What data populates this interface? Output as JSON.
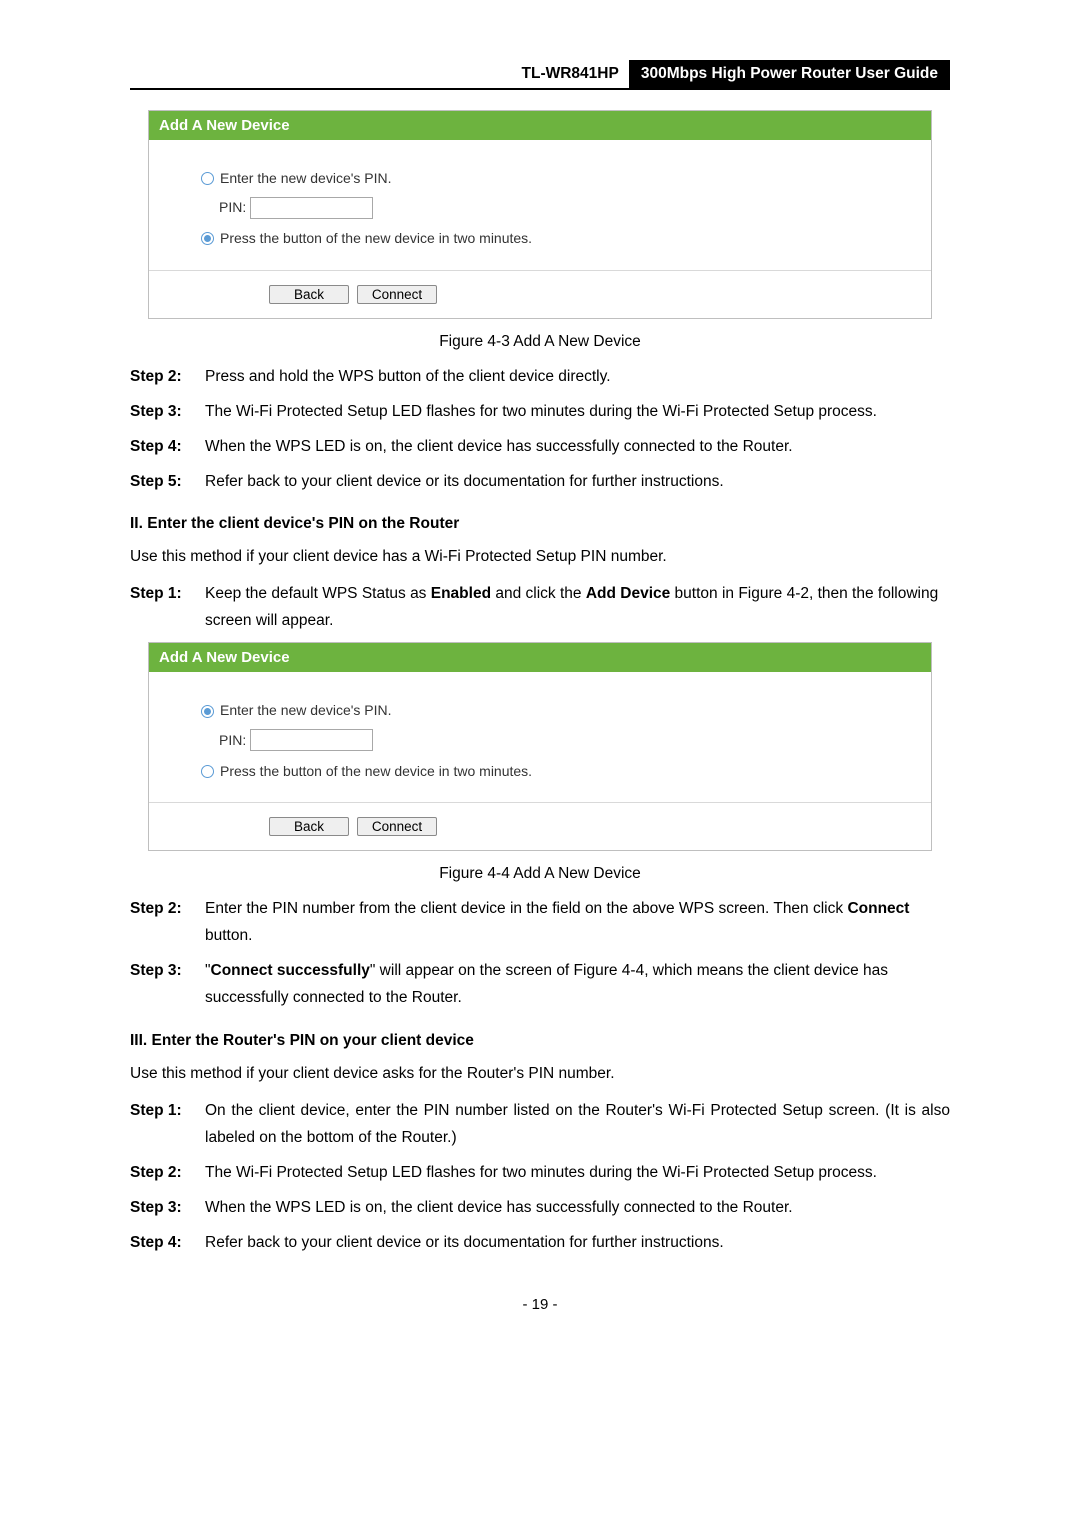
{
  "header": {
    "model": "TL-WR841HP",
    "title": "300Mbps High Power Router User Guide"
  },
  "figureA": {
    "panelTitle": "Add A New Device",
    "opt1": "Enter the new device's PIN.",
    "pinLabel": "PIN:",
    "opt2": "Press the button of the new device in two minutes.",
    "back": "Back",
    "connect": "Connect",
    "caption": "Figure 4-3 Add A New Device"
  },
  "stepsA": {
    "s2": {
      "label": "Step 2:",
      "text": "Press and hold the WPS button of the client device directly."
    },
    "s3": {
      "label": "Step 3:",
      "text": "The Wi-Fi Protected Setup LED flashes for two minutes during the Wi-Fi Protected Setup process."
    },
    "s4": {
      "label": "Step 4:",
      "text": "When the WPS LED is on, the client device has successfully connected to the Router."
    },
    "s5": {
      "label": "Step 5:",
      "text": "Refer back to your client device or its documentation for further instructions."
    }
  },
  "section2": {
    "heading": "II.   Enter the client device's PIN on the Router",
    "intro": "Use this method if your client device has a Wi-Fi Protected Setup PIN number.",
    "step1": {
      "label": "Step 1:",
      "pre": "Keep the default WPS Status as ",
      "b1": "Enabled",
      "mid": " and click the ",
      "b2": "Add Device",
      "post": " button in Figure 4-2, then the following screen will appear."
    }
  },
  "figureB": {
    "panelTitle": "Add A New Device",
    "opt1": "Enter the new device's PIN.",
    "pinLabel": "PIN:",
    "opt2": "Press the button of the new device in two minutes.",
    "back": "Back",
    "connect": "Connect",
    "caption": "Figure 4-4   Add A New Device"
  },
  "stepsB": {
    "s2": {
      "label": "Step 2:",
      "pre": "Enter the PIN number from the client device in the field on the above WPS screen. Then click ",
      "b1": "Connect",
      "post": " button."
    },
    "s3": {
      "label": "Step 3:",
      "pre": "\"",
      "b1": "Connect successfully",
      "post": "\" will appear on the screen of Figure 4-4, which means the client device has successfully connected to the Router."
    }
  },
  "section3": {
    "heading": "III.  Enter the Router's PIN on your client device",
    "intro": "Use this method if your client device asks for the Router's PIN number."
  },
  "stepsC": {
    "s1": {
      "label": "Step 1:",
      "text": "On the client device, enter the PIN number listed on the Router's Wi-Fi Protected Setup screen. (It is also labeled on the bottom of the Router.)"
    },
    "s2": {
      "label": "Step 2:",
      "text": "The Wi-Fi Protected Setup LED flashes for two minutes during the Wi-Fi Protected Setup process."
    },
    "s3": {
      "label": "Step 3:",
      "text": "When the WPS LED is on, the client device has successfully connected to the Router."
    },
    "s4": {
      "label": "Step 4:",
      "text": "Refer back to your client device or its documentation for further instructions."
    }
  },
  "pageNumber": "- 19 -"
}
